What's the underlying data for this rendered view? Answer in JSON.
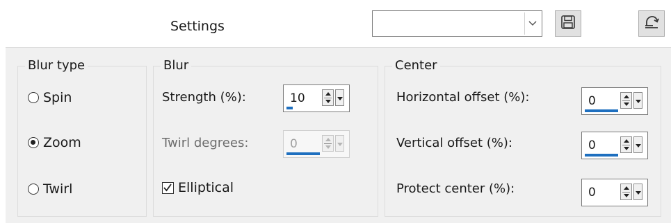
{
  "header": {
    "settings_label": "Settings",
    "preset_value": "",
    "save_icon": "floppy-disk-icon",
    "reset_icon": "reset-defaults-icon"
  },
  "blur_type": {
    "title": "Blur type",
    "options": [
      {
        "label": "Spin",
        "checked": false
      },
      {
        "label": "Zoom",
        "checked": true
      },
      {
        "label": "Twirl",
        "checked": false
      }
    ]
  },
  "blur": {
    "title": "Blur",
    "strength_label": "Strength (%):",
    "strength_value": "10",
    "strength_fraction": 0.1,
    "twirl_label": "Twirl degrees:",
    "twirl_value": "0",
    "twirl_enabled": false,
    "elliptical_label": "Elliptical",
    "elliptical_checked": true
  },
  "center": {
    "title": "Center",
    "h_offset_label": "Horizontal offset (%):",
    "h_offset_value": "0",
    "v_offset_label": "Vertical offset (%):",
    "v_offset_value": "0",
    "protect_label": "Protect center (%):",
    "protect_value": "0"
  },
  "colors": {
    "accent": "#1e6fbf",
    "panel_bg": "#f0f0f0"
  }
}
